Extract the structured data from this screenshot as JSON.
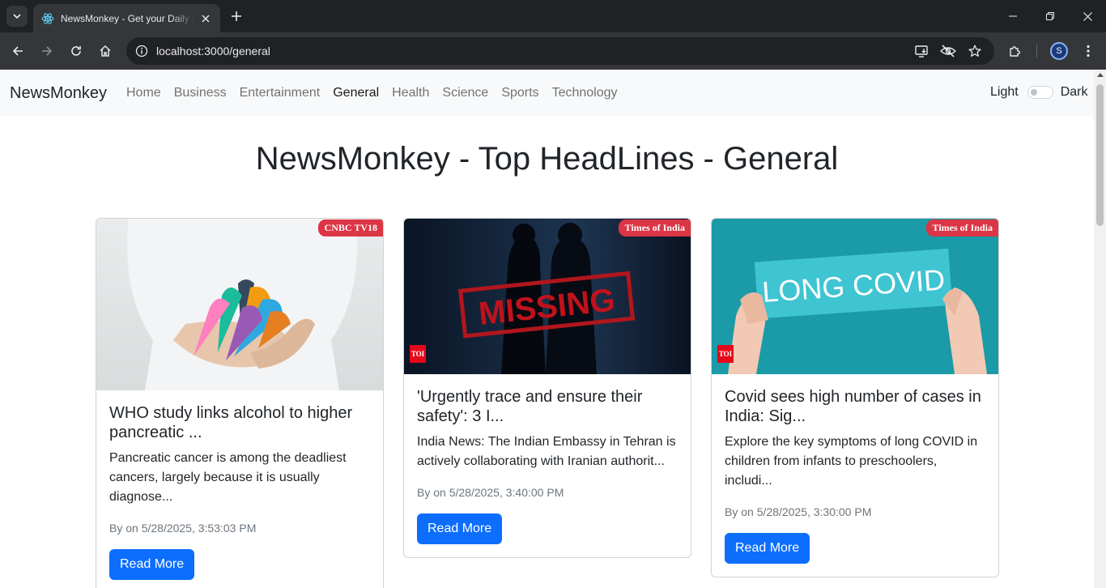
{
  "browser": {
    "tab_title": "NewsMonkey - Get your Daily dose of news",
    "url": "localhost:3000/general",
    "profile_initial": "S"
  },
  "navbar": {
    "brand": "NewsMonkey",
    "links": [
      "Home",
      "Business",
      "Entertainment",
      "General",
      "Health",
      "Science",
      "Sports",
      "Technology"
    ],
    "active": "General",
    "theme_light": "Light",
    "theme_dark": "Dark"
  },
  "page": {
    "title": "NewsMonkey - Top HeadLines - General"
  },
  "cards": [
    {
      "source": "CNBC TV18",
      "image": "awareness-ribbons-in-hands",
      "title": "WHO study links alcohol to higher pancreatic ...",
      "description": "Pancreatic cancer is among the deadliest cancers, largely because it is usually diagnose...",
      "meta": "By on 5/28/2025, 3:53:03 PM",
      "button": "Read More"
    },
    {
      "source": "Times of India",
      "image": "missing-stamp-silhouettes",
      "image_text": "MISSING",
      "logo_text": "TOI",
      "title": "'Urgently trace and ensure their safety': 3 I...",
      "description": "India News: The Indian Embassy in Tehran is actively collaborating with Iranian authorit...",
      "meta": "By on 5/28/2025, 3:40:00 PM",
      "button": "Read More"
    },
    {
      "source": "Times of India",
      "image": "long-covid-sign",
      "image_text": "LONG COVID",
      "logo_text": "TOI",
      "title": "Covid sees high number of cases in India: Sig...",
      "description": "Explore the key symptoms of long COVID in children from infants to preschoolers, includi...",
      "meta": "By on 5/28/2025, 3:30:00 PM",
      "button": "Read More"
    }
  ],
  "colors": {
    "primary": "#0d6efd",
    "badge": "#dc3545",
    "navbar_bg": "#f8f9fa",
    "chrome_dark": "#202124",
    "chrome_toolbar": "#35363a"
  }
}
